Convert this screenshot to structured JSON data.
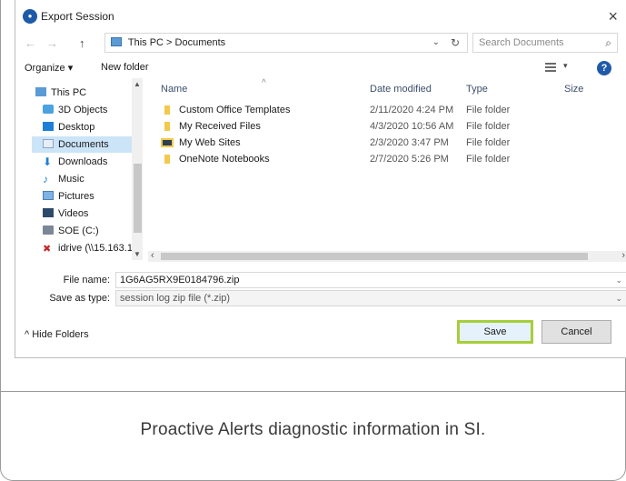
{
  "dialog": {
    "title": "Export Session",
    "title_icon": "app-logo-icon",
    "close_label": "×"
  },
  "nav": {
    "back": "←",
    "forward": "→",
    "up": "↑",
    "breadcrumb": "This PC  >  Documents",
    "search_placeholder": "Search Documents"
  },
  "toolbar": {
    "organize": "Organize ▾",
    "new_folder": "New folder",
    "help": "?"
  },
  "sidebar": {
    "items": [
      {
        "label": "This PC",
        "icon": "computer-icon"
      },
      {
        "label": "3D Objects",
        "icon": "3d-objects-icon"
      },
      {
        "label": "Desktop",
        "icon": "desktop-icon"
      },
      {
        "label": "Documents",
        "icon": "documents-icon",
        "selected": true
      },
      {
        "label": "Downloads",
        "icon": "download-icon"
      },
      {
        "label": "Music",
        "icon": "music-icon"
      },
      {
        "label": "Pictures",
        "icon": "pictures-icon"
      },
      {
        "label": "Videos",
        "icon": "videos-icon"
      },
      {
        "label": "SOE (C:)",
        "icon": "drive-icon"
      },
      {
        "label": "idrive (\\\\15.163.1",
        "icon": "network-drive-icon"
      }
    ]
  },
  "files": {
    "columns": [
      "Name",
      "Date modified",
      "Type",
      "Size"
    ],
    "rows": [
      {
        "name": "Custom Office Templates",
        "date": "2/11/2020 4:24 PM",
        "type": "File folder"
      },
      {
        "name": "My Received Files",
        "date": "4/3/2020 10:56 AM",
        "type": "File folder"
      },
      {
        "name": "My Web Sites",
        "date": "2/3/2020 3:47 PM",
        "type": "File folder"
      },
      {
        "name": "OneNote Notebooks",
        "date": "2/7/2020 5:26 PM",
        "type": "File folder"
      }
    ]
  },
  "form": {
    "file_name_label": "File name:",
    "file_name_value": "1G6AG5RX9E0184796.zip",
    "save_type_label": "Save as type:",
    "save_type_value": "session log zip file (*.zip)"
  },
  "footer": {
    "hide_folders": "^  Hide Folders",
    "save": "Save",
    "cancel": "Cancel"
  },
  "caption": "Proactive Alerts diagnostic information in SI.",
  "colors": {
    "save_highlight": "#a6ce39",
    "selection": "#cce4f7",
    "accent": "#1e5aa8"
  }
}
